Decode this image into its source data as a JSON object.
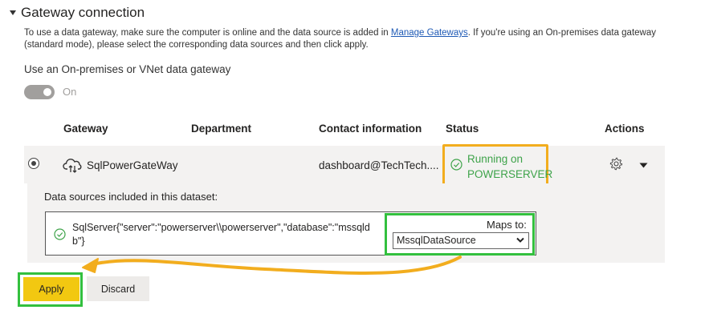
{
  "section": {
    "title": "Gateway connection",
    "description_before_link": "To use a data gateway, make sure the computer is online and the data source is added in ",
    "link_text": "Manage Gateways",
    "description_after_link": ". If you're using an On-premises data gateway (standard mode), please select the corresponding data sources and then click apply."
  },
  "toggle": {
    "label": "Use an On-premises or VNet data gateway",
    "state_text": "On"
  },
  "table": {
    "headers": {
      "gateway": "Gateway",
      "department": "Department",
      "contact": "Contact information",
      "status": "Status",
      "actions": "Actions"
    },
    "row": {
      "gateway_name": "SqlPowerGateWay",
      "department": "",
      "contact": "dashboard@TechTech....",
      "status_line1": "Running on",
      "status_line2": "POWERSERVER",
      "status_color": "#3ea34a",
      "icons": [
        "cloud-gateway-icon",
        "check-circle-icon",
        "gear-icon",
        "caret-down-icon"
      ]
    }
  },
  "datasources": {
    "label": "Data sources included in this dataset:",
    "source_text": "SqlServer{\"server\":\"powerserver\\\\powerserver\",\"database\":\"mssqldb\"}",
    "maps_to_label": "Maps to:",
    "selected_value": "MssqlDataSource"
  },
  "buttons": {
    "apply": "Apply",
    "discard": "Discard"
  },
  "colors": {
    "highlight_orange": "#f2ad1e",
    "highlight_green": "#33c03e",
    "apply_yellow": "#f2c811"
  }
}
